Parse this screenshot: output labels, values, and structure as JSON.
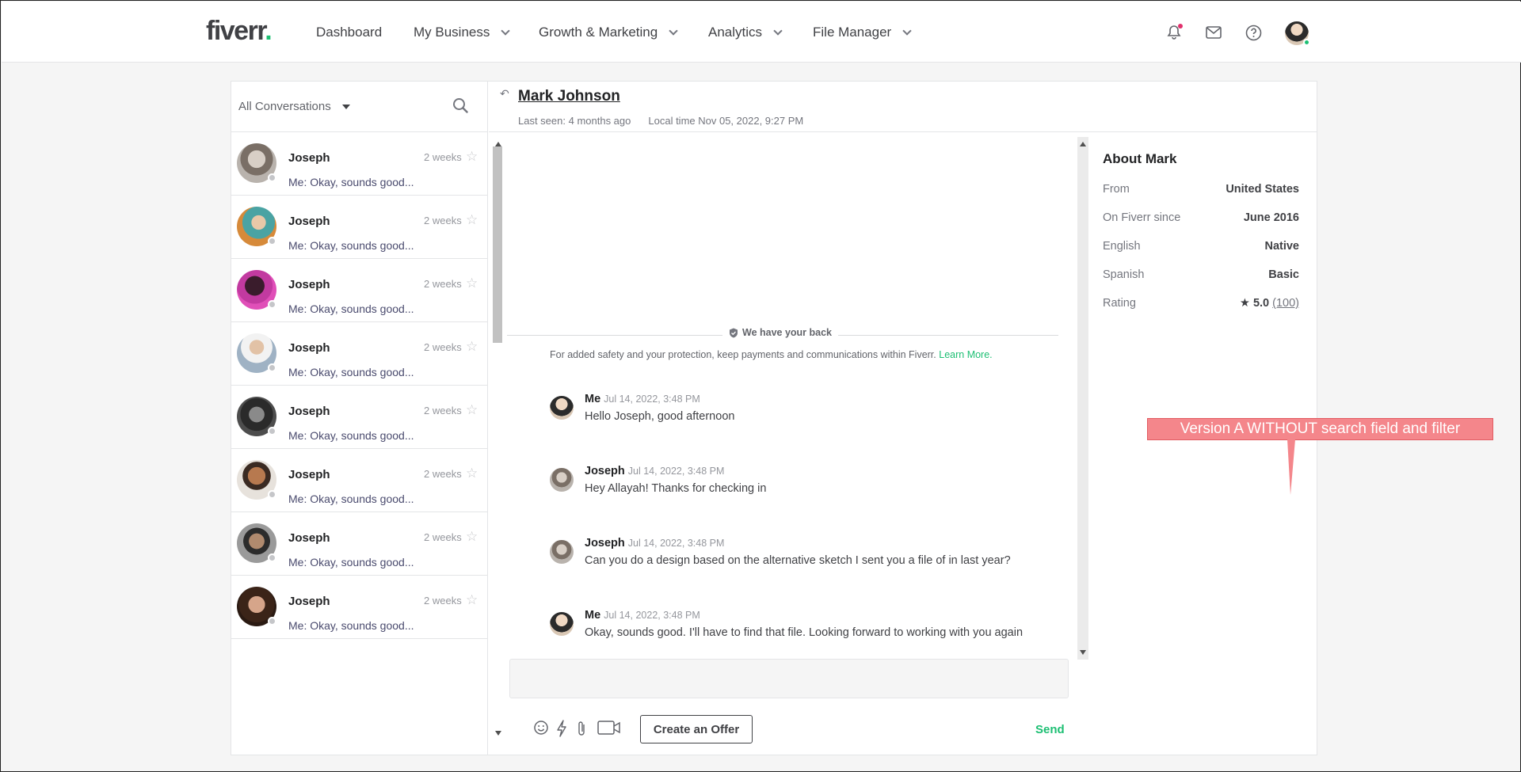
{
  "nav": {
    "logo_text": "fiverr",
    "logo_dot": ".",
    "items": [
      {
        "label": "Dashboard"
      },
      {
        "label": "My Business"
      },
      {
        "label": "Growth & Marketing"
      },
      {
        "label": "Analytics"
      },
      {
        "label": "File Manager"
      }
    ],
    "icons": [
      "bell-icon",
      "mail-icon",
      "help-icon"
    ],
    "brand_color": "#1dbf73"
  },
  "sidebar": {
    "filter_label": "All Conversations",
    "conversations": [
      {
        "name": "Joseph",
        "time": "2 weeks",
        "preview": "Me: Okay, sounds good..."
      },
      {
        "name": "Joseph",
        "time": "2 weeks",
        "preview": "Me: Okay, sounds good..."
      },
      {
        "name": "Joseph",
        "time": "2 weeks",
        "preview": "Me: Okay, sounds good..."
      },
      {
        "name": "Joseph",
        "time": "2 weeks",
        "preview": "Me: Okay, sounds good..."
      },
      {
        "name": "Joseph",
        "time": "2 weeks",
        "preview": "Me: Okay, sounds good..."
      },
      {
        "name": "Joseph",
        "time": "2 weeks",
        "preview": "Me: Okay, sounds good..."
      },
      {
        "name": "Joseph",
        "time": "2 weeks",
        "preview": "Me: Okay, sounds good..."
      },
      {
        "name": "Joseph",
        "time": "2 weeks",
        "preview": "Me: Okay, sounds good..."
      }
    ]
  },
  "chat": {
    "contact_name": "Mark Johnson",
    "last_seen": "Last seen: 4 months ago",
    "local_time": "Local time Nov 05, 2022, 9:27 PM",
    "safety_badge": "We have your back",
    "safety_text": "For added safety and your protection, keep payments and communications within Fiverr.",
    "safety_link": "Learn More.",
    "messages": [
      {
        "sender": "Me",
        "time": "Jul 14, 2022, 3:48 PM",
        "text": "Hello Joseph, good afternoon"
      },
      {
        "sender": "Joseph",
        "time": "Jul 14, 2022, 3:48 PM",
        "text": "Hey Allayah! Thanks for checking in"
      },
      {
        "sender": "Joseph",
        "time": "Jul 14, 2022, 3:48 PM",
        "text": "Can you do a design based on the alternative sketch I sent you a file of in last year?"
      },
      {
        "sender": "Me",
        "time": "Jul 14, 2022, 3:48 PM",
        "text": "Okay, sounds good. I'll have to find that file. Looking forward to working with you again"
      }
    ],
    "offer_button": "Create an Offer",
    "send_button": "Send"
  },
  "about": {
    "title": "About Mark",
    "rows": [
      {
        "key": "From",
        "value": "United States"
      },
      {
        "key": "On Fiverr since",
        "value": "June 2016"
      },
      {
        "key": "English",
        "value": "Native"
      },
      {
        "key": "Spanish",
        "value": "Basic"
      }
    ],
    "rating_label": "Rating",
    "rating_value": "5.0",
    "rating_count": "(100)"
  },
  "annotation": {
    "text": "Version A WITHOUT search field and filter"
  }
}
